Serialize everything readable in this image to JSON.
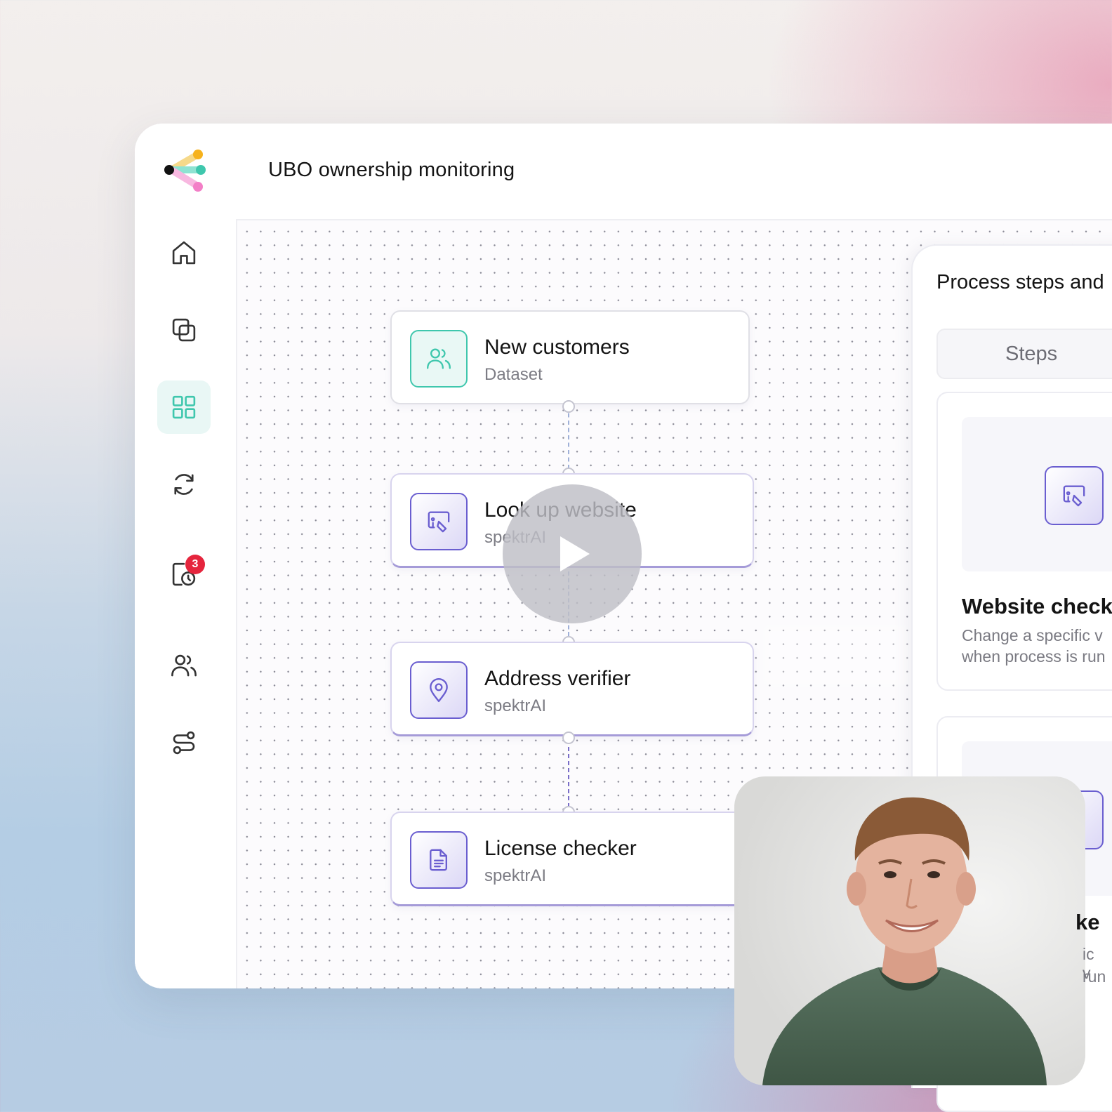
{
  "header": {
    "title": "UBO ownership monitoring"
  },
  "sidebar": {
    "items": [
      {
        "name": "home",
        "icon": "home-icon"
      },
      {
        "name": "copy",
        "icon": "copy-icon"
      },
      {
        "name": "dashboard",
        "icon": "grid-icon",
        "active": true
      },
      {
        "name": "sync",
        "icon": "refresh-icon"
      },
      {
        "name": "scheduled",
        "icon": "clock-file-icon",
        "badge": "3"
      },
      {
        "name": "users",
        "icon": "users-icon"
      },
      {
        "name": "flows",
        "icon": "flow-icon"
      }
    ]
  },
  "flow": {
    "nodes": [
      {
        "title": "New customers",
        "subtitle": "Dataset",
        "icon": "users-icon",
        "color": "#3fc7ad"
      },
      {
        "title": "Look up website",
        "subtitle": "spektrAI",
        "icon": "website-check-icon",
        "color": "#6a5ed0"
      },
      {
        "title": "Address verifier",
        "subtitle": "spektrAI",
        "icon": "location-pin-icon",
        "color": "#6a5ed0"
      },
      {
        "title": "License checker",
        "subtitle": "spektrAI",
        "icon": "document-icon",
        "color": "#6a5ed0"
      }
    ]
  },
  "panel": {
    "title": "Process steps and",
    "tab": "Steps",
    "card": {
      "title": "Website checke",
      "desc_line1": "Change a specific v",
      "desc_line2": "when process is run"
    },
    "card2_fragment": {
      "title": "ke",
      "desc_line1": "ic v",
      "desc_line2": "run"
    }
  },
  "video": {
    "play_icon": "play-icon"
  },
  "colors": {
    "accent_teal": "#3fc7ad",
    "accent_purple": "#6a5ed0",
    "badge_red": "#e5253d"
  }
}
